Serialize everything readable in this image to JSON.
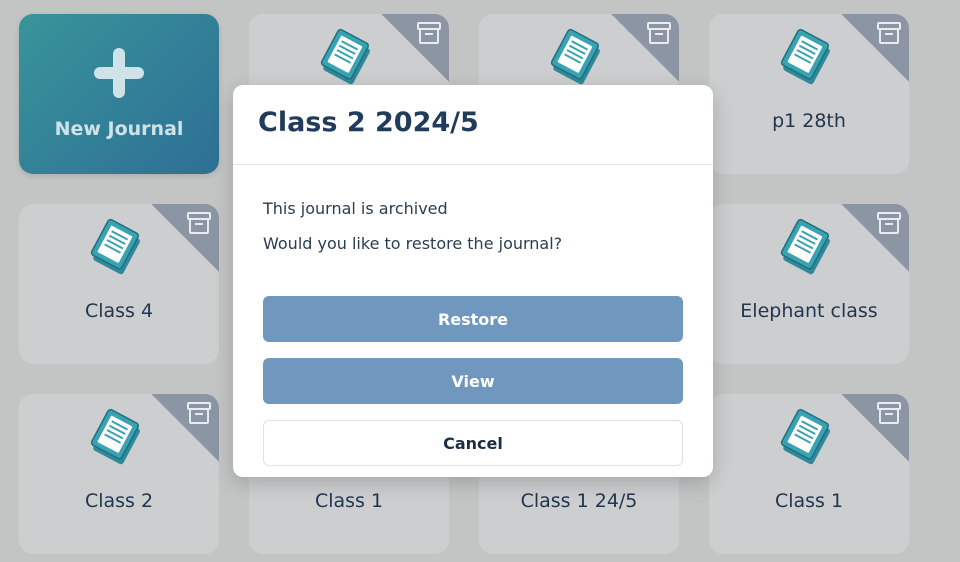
{
  "journals": {
    "new_journal_label": "New Journal",
    "cards": [
      {
        "label": "",
        "archived": true
      },
      {
        "label": "",
        "archived": true
      },
      {
        "label": "p1 28th",
        "archived": true
      },
      {
        "label": "Class 4",
        "archived": true
      },
      {
        "label": "",
        "archived": true
      },
      {
        "label": "",
        "archived": true
      },
      {
        "label": "Elephant class",
        "archived": true
      },
      {
        "label": "Class 2",
        "archived": true
      },
      {
        "label": "Class 1",
        "archived": false
      },
      {
        "label": "Class 1 24/5",
        "archived": false
      },
      {
        "label": "Class 1",
        "archived": true
      }
    ]
  },
  "icons": {
    "journal": "journal-stack-icon",
    "archive": "archive-box-icon",
    "plus": "plus-icon"
  },
  "colors": {
    "accent_teal": "#38949a",
    "accent_blue": "#2e6f96",
    "button_blue": "#7098be",
    "title_navy": "#213b5c",
    "archive_corner": "#8b95a3"
  },
  "modal": {
    "title": "Class 2 2024/5",
    "message_archived": "This journal is archived",
    "message_question": "Would you like to restore the journal?",
    "restore_label": "Restore",
    "view_label": "View",
    "cancel_label": "Cancel"
  }
}
